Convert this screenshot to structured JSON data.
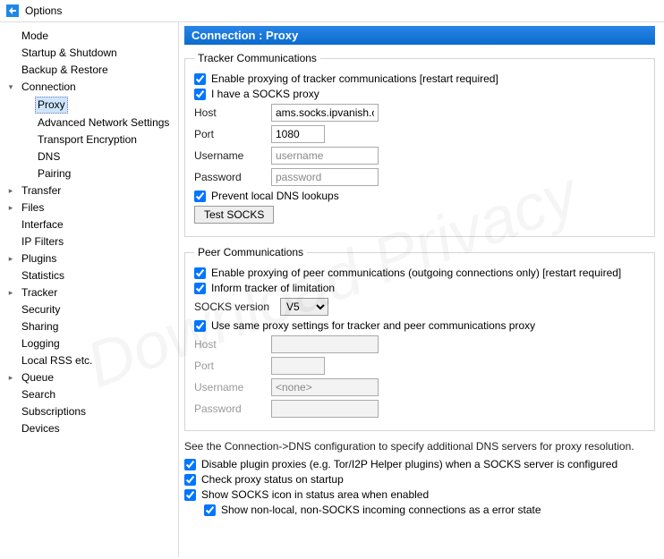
{
  "window": {
    "title": "Options"
  },
  "tree": {
    "items": [
      {
        "label": "Mode",
        "exp": ""
      },
      {
        "label": "Startup & Shutdown",
        "exp": ""
      },
      {
        "label": "Backup & Restore",
        "exp": ""
      },
      {
        "label": "Connection",
        "exp": "v",
        "children": [
          {
            "label": "Proxy",
            "selected": true
          },
          {
            "label": "Advanced Network Settings"
          },
          {
            "label": "Transport Encryption"
          },
          {
            "label": "DNS"
          },
          {
            "label": "Pairing"
          }
        ]
      },
      {
        "label": "Transfer",
        "exp": ">"
      },
      {
        "label": "Files",
        "exp": ">"
      },
      {
        "label": "Interface",
        "exp": ""
      },
      {
        "label": "IP Filters",
        "exp": ""
      },
      {
        "label": "Plugins",
        "exp": ">"
      },
      {
        "label": "Statistics",
        "exp": ""
      },
      {
        "label": "Tracker",
        "exp": ">"
      },
      {
        "label": "Security",
        "exp": ""
      },
      {
        "label": "Sharing",
        "exp": ""
      },
      {
        "label": "Logging",
        "exp": ""
      },
      {
        "label": "Local RSS etc.",
        "exp": ""
      },
      {
        "label": "Queue",
        "exp": ">"
      },
      {
        "label": "Search",
        "exp": ""
      },
      {
        "label": "Subscriptions",
        "exp": ""
      },
      {
        "label": "Devices",
        "exp": ""
      }
    ]
  },
  "panel": {
    "title": "Connection : Proxy",
    "tracker": {
      "legend": "Tracker Communications",
      "enable": "Enable proxying of tracker communications [restart required]",
      "haveSocks": "I have a SOCKS proxy",
      "hostLabel": "Host",
      "hostValue": "ams.socks.ipvanish.c",
      "portLabel": "Port",
      "portValue": "1080",
      "userLabel": "Username",
      "userValue": "username",
      "pwdLabel": "Password",
      "pwdValue": "password",
      "preventDns": "Prevent local DNS lookups",
      "testBtn": "Test SOCKS"
    },
    "peer": {
      "legend": "Peer Communications",
      "enable": "Enable proxying of peer communications (outgoing connections only) [restart required]",
      "inform": "Inform tracker of limitation",
      "versionLabel": "SOCKS version",
      "versionValue": "V5",
      "useSame": "Use same proxy settings for tracker and peer communications proxy",
      "hostLabel": "Host",
      "portLabel": "Port",
      "userLabel": "Username",
      "userValue": "<none>",
      "pwdLabel": "Password"
    },
    "footer": {
      "note": "See the Connection->DNS configuration to specify additional DNS servers for proxy resolution.",
      "disablePlugin": "Disable plugin proxies (e.g. Tor/I2P Helper plugins) when a SOCKS server is configured",
      "checkStartup": "Check proxy status on startup",
      "showIcon": "Show SOCKS icon in status area when enabled",
      "showNonLocal": "Show non-local, non-SOCKS incoming connections as a error state"
    }
  }
}
